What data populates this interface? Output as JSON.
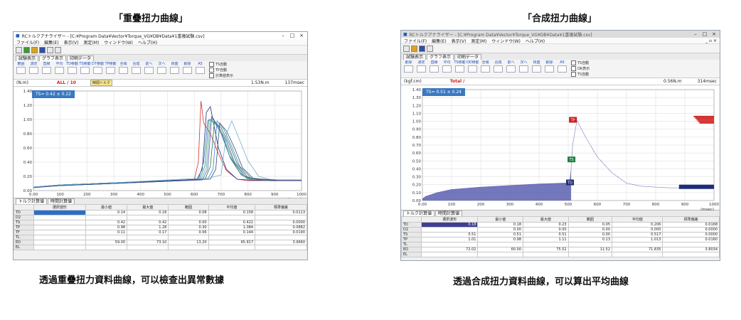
{
  "captions": {
    "left_title": "「重疊扭力曲線」",
    "right_title": "「合成扭力曲線」",
    "left_desc": "透過重疊扭力資料曲線，可以檢查出異常數據",
    "right_desc": "透過合成扭力資料曲線，可以算出平均曲線"
  },
  "left": {
    "window_title": "RCトルクアナライザー - [C:¥Program Data¥Vector¥Torque_VG¥DB¥Data¥1重複試験.csv]",
    "menu": [
      "ファイル(F)",
      "編集(E)",
      "表示(V)",
      "測定(M)",
      "ウィンドウ(W)",
      "ヘルプ(H)"
    ],
    "tabs": [
      "試験表示",
      "グラフ表示",
      "印刷データ"
    ],
    "tools": [
      "範囲",
      "測定",
      "直線",
      "平均",
      "TD移動",
      "TS移動",
      "DT移動",
      "TP移動",
      "全域",
      "合成",
      "前へ",
      "次へ",
      "目盛",
      "削除",
      "A5"
    ],
    "checks": [
      "TS自動",
      "TP自動",
      "計算値表示"
    ],
    "status": {
      "unit": "(N.m)",
      "count": "ALL / 10",
      "badge": "時間トルク",
      "peak": "1.53N.m",
      "time": "137msec"
    },
    "ts_box": "TS=  0.42 ±  0.22",
    "bottom_tabs": [
      "トルク計算値",
      "時間計算値"
    ],
    "table_headers": [
      "",
      "選択波形",
      "最小値",
      "最大値",
      "範囲",
      "平均値",
      "標準偏差"
    ],
    "rows": [
      {
        "label": "TD",
        "sel": "",
        "min": "0.14",
        "max": "0.18",
        "range": "0.08",
        "avg": "0.158",
        "sd": "0.0113"
      },
      {
        "label": "D2",
        "sel": "",
        "min": "",
        "max": "",
        "range": "",
        "avg": "",
        "sd": ""
      },
      {
        "label": "TS",
        "sel": "",
        "min": "0.42",
        "max": "0.42",
        "range": "0.00",
        "avg": "0.422",
        "sd": "0.0000"
      },
      {
        "label": "TP",
        "sel": "",
        "min": "0.98",
        "max": "1.28",
        "range": "0.30",
        "avg": "1.084",
        "sd": "0.0882"
      },
      {
        "label": "TF",
        "sel": "",
        "min": "0.11",
        "max": "0.17",
        "range": "0.06",
        "avg": "0.144",
        "sd": "0.0190"
      },
      {
        "label": "TL",
        "sel": "",
        "min": "",
        "max": "",
        "range": "",
        "avg": "",
        "sd": ""
      },
      {
        "label": "ED",
        "sel": "",
        "min": "59.00",
        "max": "73.10",
        "range": "13.20",
        "avg": "65.817",
        "sd": "3.9660"
      },
      {
        "label": "EL",
        "sel": "",
        "min": "",
        "max": "",
        "range": "",
        "avg": "",
        "sd": ""
      }
    ]
  },
  "right": {
    "window_title": "RCトルクアナライザー - [C:¥Program Data¥Vector¥Torque_VG¥DB¥Data¥1重複試験.csv]",
    "menu": [
      "ファイル(F)",
      "編集(E)",
      "表示(V)",
      "測定(M)",
      "ウィンドウ(W)",
      "ヘルプ(H)"
    ],
    "tabs": [
      "試験表示",
      "グラフ表示",
      "印刷データ"
    ],
    "tools": [
      "削除",
      "測定",
      "直線",
      "平均",
      "TS移動",
      "OD移動",
      "全域",
      "合成",
      "前へ",
      "次へ",
      "目盛",
      "削除",
      "A5"
    ],
    "checks": [
      "TS自動",
      "OK表示",
      "TS自動"
    ],
    "status": {
      "unit": "(kgf.cm)",
      "count": "Total /",
      "peak": "0.56N.m",
      "time": "314msec"
    },
    "ts_box": "TS=  0.51 ±  0.24",
    "markers": {
      "tp": "TP",
      "ts": "TS",
      "td": "TD"
    },
    "bottom_tabs": [
      "トルク計算値",
      "時間計算値"
    ],
    "table_headers": [
      "",
      "選択波形",
      "最小値",
      "最大値",
      "範囲",
      "平均値",
      "標準偏差"
    ],
    "rows": [
      {
        "label": "TD",
        "sel": "0.18",
        "min": "0.18",
        "max": "0.23",
        "range": "0.05",
        "avg": "0.206",
        "sd": "0.0168"
      },
      {
        "label": "D2",
        "sel": "",
        "min": "0.00",
        "max": "0.00",
        "range": "0.00",
        "avg": "0.000",
        "sd": "0.0000"
      },
      {
        "label": "TS",
        "sel": "0.51",
        "min": "0.51",
        "max": "0.51",
        "range": "0.00",
        "avg": "0.517",
        "sd": "0.0000"
      },
      {
        "label": "TP",
        "sel": "1.01",
        "min": "0.98",
        "max": "1.11",
        "range": "0.13",
        "avg": "1.013",
        "sd": "0.0160"
      },
      {
        "label": "TL",
        "sel": "",
        "min": "",
        "max": "",
        "range": "",
        "avg": "",
        "sd": ""
      },
      {
        "label": "ED",
        "sel": "72.02",
        "min": "60.00",
        "max": "75.52",
        "range": "11.52",
        "avg": "71.835",
        "sd": "3.8034"
      },
      {
        "label": "EL",
        "sel": "",
        "min": "",
        "max": "",
        "range": "",
        "avg": "",
        "sd": ""
      }
    ]
  },
  "chart_data": [
    {
      "type": "line",
      "title": "",
      "xlabel": "(msec)",
      "ylabel": "(N.m)",
      "xlim": [
        0,
        1000
      ],
      "ylim": [
        0,
        1.4
      ],
      "x_ticks": [
        "0.00",
        "100",
        "200",
        "300",
        "400",
        "500",
        "600",
        "700",
        "800",
        "900",
        "1000"
      ],
      "y_ticks": [
        "0.00",
        "0.20",
        "0.40",
        "0.60",
        "0.80",
        "1.00",
        "1.20",
        "1.40"
      ],
      "colors": [
        "#d03030",
        "#203080",
        "#3070c0",
        "#309060",
        "#50a0b0",
        "#6050a0",
        "#208040",
        "#4080d0",
        "#305070",
        "#70b0d0"
      ],
      "series": [
        {
          "x": [
            0,
            100,
            300,
            500,
            600,
            615,
            625,
            635,
            660,
            690,
            720,
            760,
            800,
            900,
            1000
          ],
          "y": [
            0.05,
            0.07,
            0.1,
            0.13,
            0.15,
            0.4,
            1.26,
            0.95,
            0.8,
            0.52,
            0.28,
            0.16,
            0.14,
            0.14,
            0.14
          ]
        },
        {
          "x": [
            0,
            100,
            300,
            500,
            610,
            630,
            645,
            660,
            690,
            720,
            760,
            800,
            900,
            1000
          ],
          "y": [
            0.05,
            0.08,
            0.11,
            0.14,
            0.16,
            0.3,
            1.1,
            1.18,
            0.6,
            0.3,
            0.16,
            0.15,
            0.14,
            0.14
          ]
        },
        {
          "x": [
            0,
            100,
            300,
            500,
            615,
            635,
            650,
            670,
            700,
            730,
            770,
            800,
            900,
            1000
          ],
          "y": [
            0.04,
            0.07,
            0.1,
            0.13,
            0.15,
            0.4,
            0.98,
            1.02,
            0.8,
            0.5,
            0.25,
            0.16,
            0.15,
            0.15
          ]
        },
        {
          "x": [
            0,
            100,
            300,
            500,
            620,
            640,
            655,
            675,
            705,
            735,
            775,
            810,
            900,
            1000
          ],
          "y": [
            0.05,
            0.08,
            0.11,
            0.14,
            0.16,
            0.35,
            1.0,
            0.96,
            0.78,
            0.45,
            0.22,
            0.16,
            0.15,
            0.15
          ]
        },
        {
          "x": [
            0,
            100,
            300,
            500,
            625,
            645,
            660,
            680,
            710,
            745,
            785,
            820,
            900,
            1000
          ],
          "y": [
            0.05,
            0.07,
            0.1,
            0.14,
            0.16,
            0.32,
            0.99,
            0.94,
            0.74,
            0.42,
            0.2,
            0.16,
            0.15,
            0.15
          ]
        },
        {
          "x": [
            0,
            100,
            300,
            500,
            630,
            650,
            665,
            690,
            720,
            750,
            790,
            830,
            900,
            1000
          ],
          "y": [
            0.04,
            0.07,
            0.1,
            0.13,
            0.15,
            0.3,
            1.04,
            0.9,
            0.7,
            0.4,
            0.2,
            0.16,
            0.15,
            0.15
          ]
        },
        {
          "x": [
            0,
            100,
            300,
            500,
            640,
            660,
            675,
            700,
            730,
            760,
            800,
            840,
            900,
            1000
          ],
          "y": [
            0.05,
            0.08,
            0.11,
            0.14,
            0.16,
            0.34,
            0.97,
            0.88,
            0.66,
            0.38,
            0.18,
            0.16,
            0.15,
            0.15
          ]
        },
        {
          "x": [
            0,
            100,
            300,
            500,
            650,
            670,
            685,
            710,
            740,
            770,
            810,
            850,
            900,
            1000
          ],
          "y": [
            0.05,
            0.08,
            0.11,
            0.14,
            0.16,
            0.3,
            0.98,
            0.86,
            0.62,
            0.34,
            0.18,
            0.16,
            0.15,
            0.15
          ]
        },
        {
          "x": [
            0,
            100,
            300,
            500,
            660,
            680,
            695,
            720,
            750,
            780,
            820,
            860,
            900,
            1000
          ],
          "y": [
            0.05,
            0.07,
            0.1,
            0.14,
            0.16,
            0.3,
            0.95,
            0.84,
            0.6,
            0.32,
            0.17,
            0.16,
            0.15,
            0.15
          ]
        },
        {
          "x": [
            0,
            100,
            300,
            500,
            660,
            700,
            720,
            740,
            770,
            800,
            840,
            880,
            920,
            1000
          ],
          "y": [
            0.05,
            0.08,
            0.11,
            0.15,
            0.18,
            0.22,
            0.8,
            0.98,
            0.7,
            0.42,
            0.2,
            0.16,
            0.15,
            0.15
          ]
        }
      ]
    },
    {
      "type": "area",
      "title": "",
      "xlabel": "(msec)",
      "ylabel": "(kgf.cm)",
      "xlim": [
        0,
        1000
      ],
      "ylim": [
        0,
        1.4
      ],
      "x_ticks": [
        "0.00",
        "100",
        "200",
        "300",
        "400",
        "500",
        "600",
        "700",
        "800",
        "900",
        "1000"
      ],
      "y_ticks": [
        "0.00",
        "0.10",
        "0.20",
        "0.30",
        "0.40",
        "0.50",
        "0.60",
        "0.70",
        "0.80",
        "0.90",
        "1.00",
        "1.10",
        "1.20",
        "1.30",
        "1.40"
      ],
      "fill_color": "#5a5fb0",
      "series": [
        {
          "x": [
            0,
            10,
            50,
            100,
            200,
            300,
            400,
            480,
            505,
            510,
            515,
            530,
            560,
            600,
            650,
            700,
            750,
            800,
            850,
            900,
            950,
            1000
          ],
          "y": [
            0.02,
            0.05,
            0.1,
            0.14,
            0.17,
            0.19,
            0.21,
            0.22,
            0.22,
            0.4,
            0.7,
            1.01,
            0.8,
            0.55,
            0.35,
            0.22,
            0.18,
            0.17,
            0.16,
            0.16,
            0.16,
            0.16
          ]
        }
      ],
      "distribution_color": "#d02020"
    }
  ]
}
